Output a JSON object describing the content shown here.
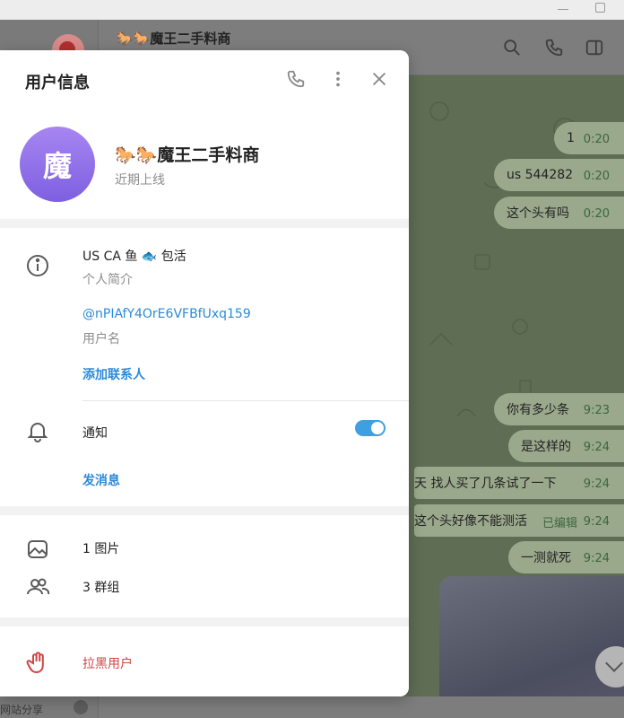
{
  "window": {
    "minimize_icon": "minimize-icon",
    "maximize_icon": "maximize-icon"
  },
  "left_panel": {
    "bottom_text": "网站分享"
  },
  "chat": {
    "title": "🐎🐎魔王二手料商",
    "header_icons": [
      "search-icon",
      "phone-icon",
      "sidebar-toggle-icon"
    ],
    "messages": [
      {
        "text": "1",
        "time": "0:20"
      },
      {
        "text": "us  544282",
        "time": "0:20"
      },
      {
        "text": "这个头有吗",
        "time": "0:20"
      },
      {
        "text": "你有多少条",
        "time": "9:23"
      },
      {
        "text": "是这样的",
        "time": "9:24"
      },
      {
        "text": "天 找人买了几条试了一下",
        "time": "9:24"
      },
      {
        "text": "这个头好像不能测活",
        "time": "9:24",
        "edited": "已编辑"
      },
      {
        "text": "一测就死",
        "time": "9:24"
      }
    ]
  },
  "profile": {
    "title": "用户信息",
    "avatar_letter": "魔",
    "avatar_color": "#8b6ee8",
    "name": "🐎🐎魔王二手料商",
    "status": "近期上线",
    "bio": "US CA 鱼 🐟 包活",
    "bio_label": "个人简介",
    "username": "@nPIAfY4OrE6VFBfUxq159",
    "username_label": "用户名",
    "add_contact": "添加联系人",
    "notifications_label": "通知",
    "notifications_on": true,
    "send_message": "发消息",
    "photos": "1 图片",
    "groups": "3 群组",
    "block": "拉黑用户",
    "accent_color": "#2b8ad8",
    "danger_color": "#d04545"
  }
}
